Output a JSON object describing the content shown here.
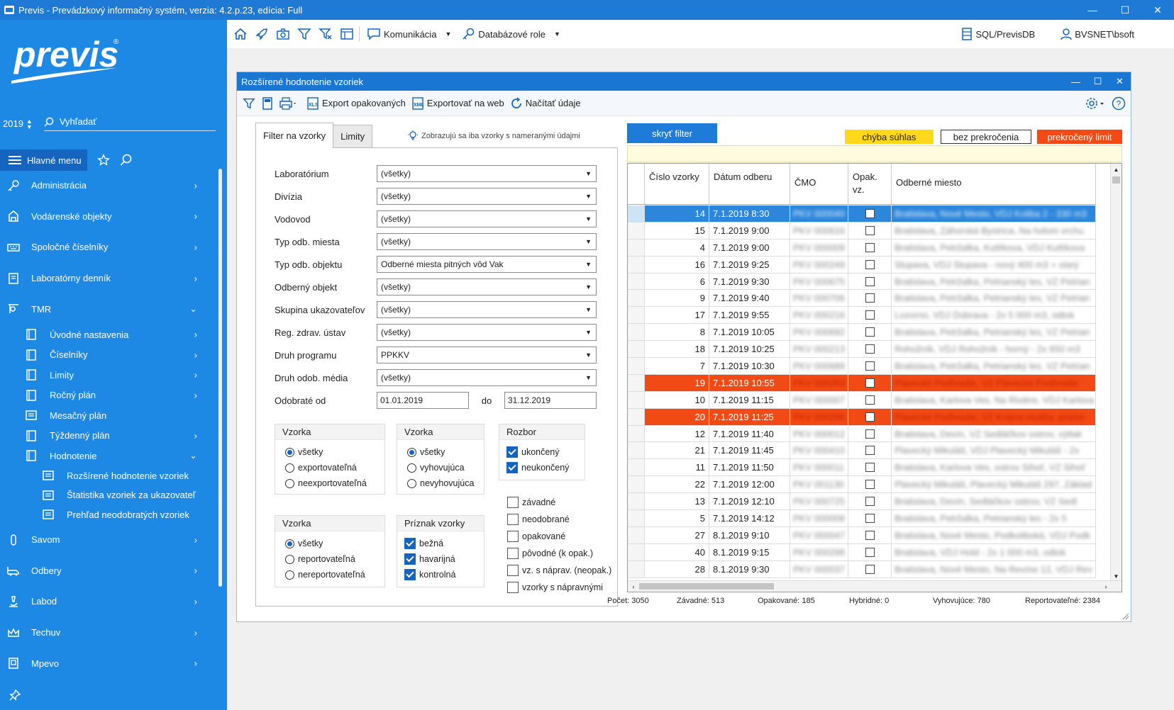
{
  "app": {
    "title": "Previs - Prevádzkový informačný systém, verzia: 4.2.p.23, edícia: Full"
  },
  "sidebar": {
    "logo_text": "previs",
    "year": "2019",
    "search_label": "Vyhľadať",
    "menu_label": "Hlavné menu",
    "items": [
      {
        "label": "Administrácia"
      },
      {
        "label": "Vodárenské objekty"
      },
      {
        "label": "Spoločné číselníky"
      },
      {
        "label": "Laboratórny denník"
      },
      {
        "label": "TMR"
      }
    ],
    "tmr_sub": [
      {
        "label": "Úvodné nastavenia"
      },
      {
        "label": "Číselníky"
      },
      {
        "label": "Limity"
      },
      {
        "label": "Ročný plán"
      },
      {
        "label": "Mesačný plán"
      },
      {
        "label": "Týždenný plán"
      },
      {
        "label": "Hodnotenie"
      }
    ],
    "hodnotenie_sub": [
      {
        "label": "Rozšírené hodnotenie vzoriek"
      },
      {
        "label": "Štatistika vzoriek za ukazovateľ"
      },
      {
        "label": "Prehľad neodobratých vzoriek"
      }
    ],
    "items_after": [
      {
        "label": "Savom"
      },
      {
        "label": "Odbery"
      },
      {
        "label": "Labod"
      },
      {
        "label": "Techuv"
      },
      {
        "label": "Mpevo"
      }
    ]
  },
  "toolbar": {
    "komunikacia": "Komunikácia",
    "databazove_role": "Databázové role",
    "db": "SQL/PrevisDB",
    "user": "BVSNET\\bsoft"
  },
  "window": {
    "title": "Rozšírené hodnotenie vzoriek",
    "export_repeated": "Export opakovaných",
    "export_web": "Exportovať na web",
    "load_data": "Načítať údaje"
  },
  "filter": {
    "tab_filter": "Filter na vzorky",
    "tab_limits": "Limity",
    "hint": "Zobrazujú sa iba vzorky s nameranými údajmi",
    "fields": [
      {
        "label": "Laboratórium",
        "value": "(všetky)"
      },
      {
        "label": "Divízia",
        "value": "(všetky)"
      },
      {
        "label": "Vodovod",
        "value": "(všetky)"
      },
      {
        "label": "Typ odb. miesta",
        "value": "(všetky)"
      },
      {
        "label": "Typ odb. objektu",
        "value": "Odberné miesta pitných vôd Vak"
      },
      {
        "label": "Odberný objekt",
        "value": "(všetky)"
      },
      {
        "label": "Skupina ukazovateľov",
        "value": "(všetky)"
      },
      {
        "label": "Reg. zdrav. ústav",
        "value": "(všetky)"
      },
      {
        "label": "Druh programu",
        "value": "PPKKV"
      },
      {
        "label": "Druh odob. média",
        "value": "(všetky)"
      }
    ],
    "date_label": "Odobraté od",
    "date_from": "01.01.2019",
    "date_to_label": "do",
    "date_to": "31.12.2019",
    "group1": {
      "title": "Vzorka",
      "options": [
        "všetky",
        "exportovateľná",
        "neexportovateľná"
      ],
      "selected": 0
    },
    "group2": {
      "title": "Vzorka",
      "options": [
        "všetky",
        "vyhovujúca",
        "nevyhovujúca"
      ],
      "selected": 0
    },
    "group3": {
      "title": "Rozbor",
      "options": [
        "ukončený",
        "neukončený"
      ]
    },
    "group4": {
      "title": "Vzorka",
      "options": [
        "všetky",
        "reportovateľná",
        "nereportovateľná"
      ],
      "selected": 0
    },
    "group5": {
      "title": "Príznak vzorky",
      "options": [
        "bežná",
        "havarijná",
        "kontrolná"
      ]
    },
    "loose_checks": [
      "závadné",
      "neodobrané",
      "opakované",
      "pôvodné (k opak.)",
      "vz. s náprav. (neopak.)",
      "vzorky s nápravnými"
    ]
  },
  "grid": {
    "hide_filter": "skryť filter",
    "legend": {
      "consent_error": "chýba súhlas",
      "no_exceed": "bez prekročenia",
      "exceeded": "prekročený limit"
    },
    "legend_colors": {
      "consent_error": "#ffd81a",
      "no_exceed": "#ffffff",
      "exceeded": "#f24a14"
    },
    "columns": {
      "c1": "Číslo vzorky",
      "c2": "Dátum odberu",
      "c3": "ČMO",
      "c4": "Opak. vz.",
      "c5": "Odberné miesto"
    },
    "rows": [
      {
        "n": "14",
        "d": "7.1.2019 8:30",
        "cmo": "PKV 000040",
        "place": "Bratislava, Nové Mesto, VDJ Koliba 2 - 330 m3",
        "state": "selected"
      },
      {
        "n": "15",
        "d": "7.1.2019 9:00",
        "cmo": "PKV 000616",
        "place": "Bratislava, Záhorská Bystrica, Na holom vrchu",
        "state": ""
      },
      {
        "n": "4",
        "d": "7.1.2019 9:00",
        "cmo": "PKV 000009",
        "place": "Bratislava, Petržalka, Kutlíkova, VDJ Kutlíkova",
        "state": ""
      },
      {
        "n": "16",
        "d": "7.1.2019 9:25",
        "cmo": "PKV 000249",
        "place": "Stupava, VDJ Stupava - nový 400 m3 + starý",
        "state": ""
      },
      {
        "n": "6",
        "d": "7.1.2019 9:30",
        "cmo": "PKV 000675",
        "place": "Bratislava, Petržalka, Petrianský les, VZ Petrian",
        "state": ""
      },
      {
        "n": "9",
        "d": "7.1.2019 9:40",
        "cmo": "PKV 000706",
        "place": "Bratislava, Petržalka, Petrianský les, VZ Petrian",
        "state": ""
      },
      {
        "n": "17",
        "d": "7.1.2019 9:55",
        "cmo": "PKV 000216",
        "place": "Lozorno, VDJ Dúbrava - 2x 5 000 m3, odtok",
        "state": ""
      },
      {
        "n": "8",
        "d": "7.1.2019 10:05",
        "cmo": "PKV 000692",
        "place": "Bratislava, Petržalka, Petrianský les, VZ Petrian",
        "state": ""
      },
      {
        "n": "18",
        "d": "7.1.2019 10:25",
        "cmo": "PKV 000213",
        "place": "Rohožník, VDJ Rohožník - horný - 2x 650 m3",
        "state": ""
      },
      {
        "n": "7",
        "d": "7.1.2019 10:30",
        "cmo": "PKV 000689",
        "place": "Bratislava, Petržalka, Petrianský les, VZ Petrian",
        "state": ""
      },
      {
        "n": "19",
        "d": "7.1.2019 10:55",
        "cmo": "PKV 000283",
        "place": "Plavecké Podhradie, VZ Plavecké Podhradie",
        "state": "red"
      },
      {
        "n": "10",
        "d": "7.1.2019 11:15",
        "cmo": "PKV 000007",
        "place": "Bratislava, Karlova Ves, Na Riviére, VDJ Karlova",
        "state": ""
      },
      {
        "n": "20",
        "d": "7.1.2019 11:25",
        "cmo": "PKV 000288",
        "place": "Plavecké Podhradie, VZ Krátna studňa, prame",
        "state": "red"
      },
      {
        "n": "12",
        "d": "7.1.2019 11:40",
        "cmo": "PKV 000012",
        "place": "Bratislava, Devín, VZ Sedláčkov ostrov, výtlak",
        "state": ""
      },
      {
        "n": "21",
        "d": "7.1.2019 11:45",
        "cmo": "PKV 000410",
        "place": "Plavecký Mikuláš, VDJ Plavecký Mikuláš - 2x",
        "state": ""
      },
      {
        "n": "11",
        "d": "7.1.2019 11:50",
        "cmo": "PKV 000011",
        "place": "Bratislava, Karlova Ves, ostrov Sihoť, VZ Sihoť",
        "state": ""
      },
      {
        "n": "22",
        "d": "7.1.2019 12:00",
        "cmo": "PKV 001130",
        "place": "Plavecký Mikuláš, Plavecký Mikuláš 297, Základ",
        "state": ""
      },
      {
        "n": "13",
        "d": "7.1.2019 12:10",
        "cmo": "PKV 000725",
        "place": "Bratislava, Devín, Sedláčkov ostrov, VZ Sedl",
        "state": ""
      },
      {
        "n": "5",
        "d": "7.1.2019 14:12",
        "cmo": "PKV 000008",
        "place": "Bratislava, Petržalka, Petrianský les - 2x 5",
        "state": ""
      },
      {
        "n": "27",
        "d": "8.1.2019 9:10",
        "cmo": "PKV 000047",
        "place": "Bratislava, Nové Mesto, Podkolibská, VDJ Podk",
        "state": ""
      },
      {
        "n": "40",
        "d": "8.1.2019 9:15",
        "cmo": "PKV 000298",
        "place": "Bratislava, VDJ Hold - 2x 1 000 m3, odtok",
        "state": ""
      },
      {
        "n": "28",
        "d": "8.1.2019 9:30",
        "cmo": "PKV 000037",
        "place": "Bratislava, Nové Mesto, Na Revíne 12, VDJ Rev",
        "state": ""
      }
    ],
    "status": {
      "count": "Počet: 3050",
      "defective": "Závadné: 513",
      "repeated": "Opakované: 185",
      "hybrid": "Hybridné: 0",
      "compliant": "Vyhovujúce: 780",
      "reportable": "Reportovateľné: 2384"
    }
  }
}
